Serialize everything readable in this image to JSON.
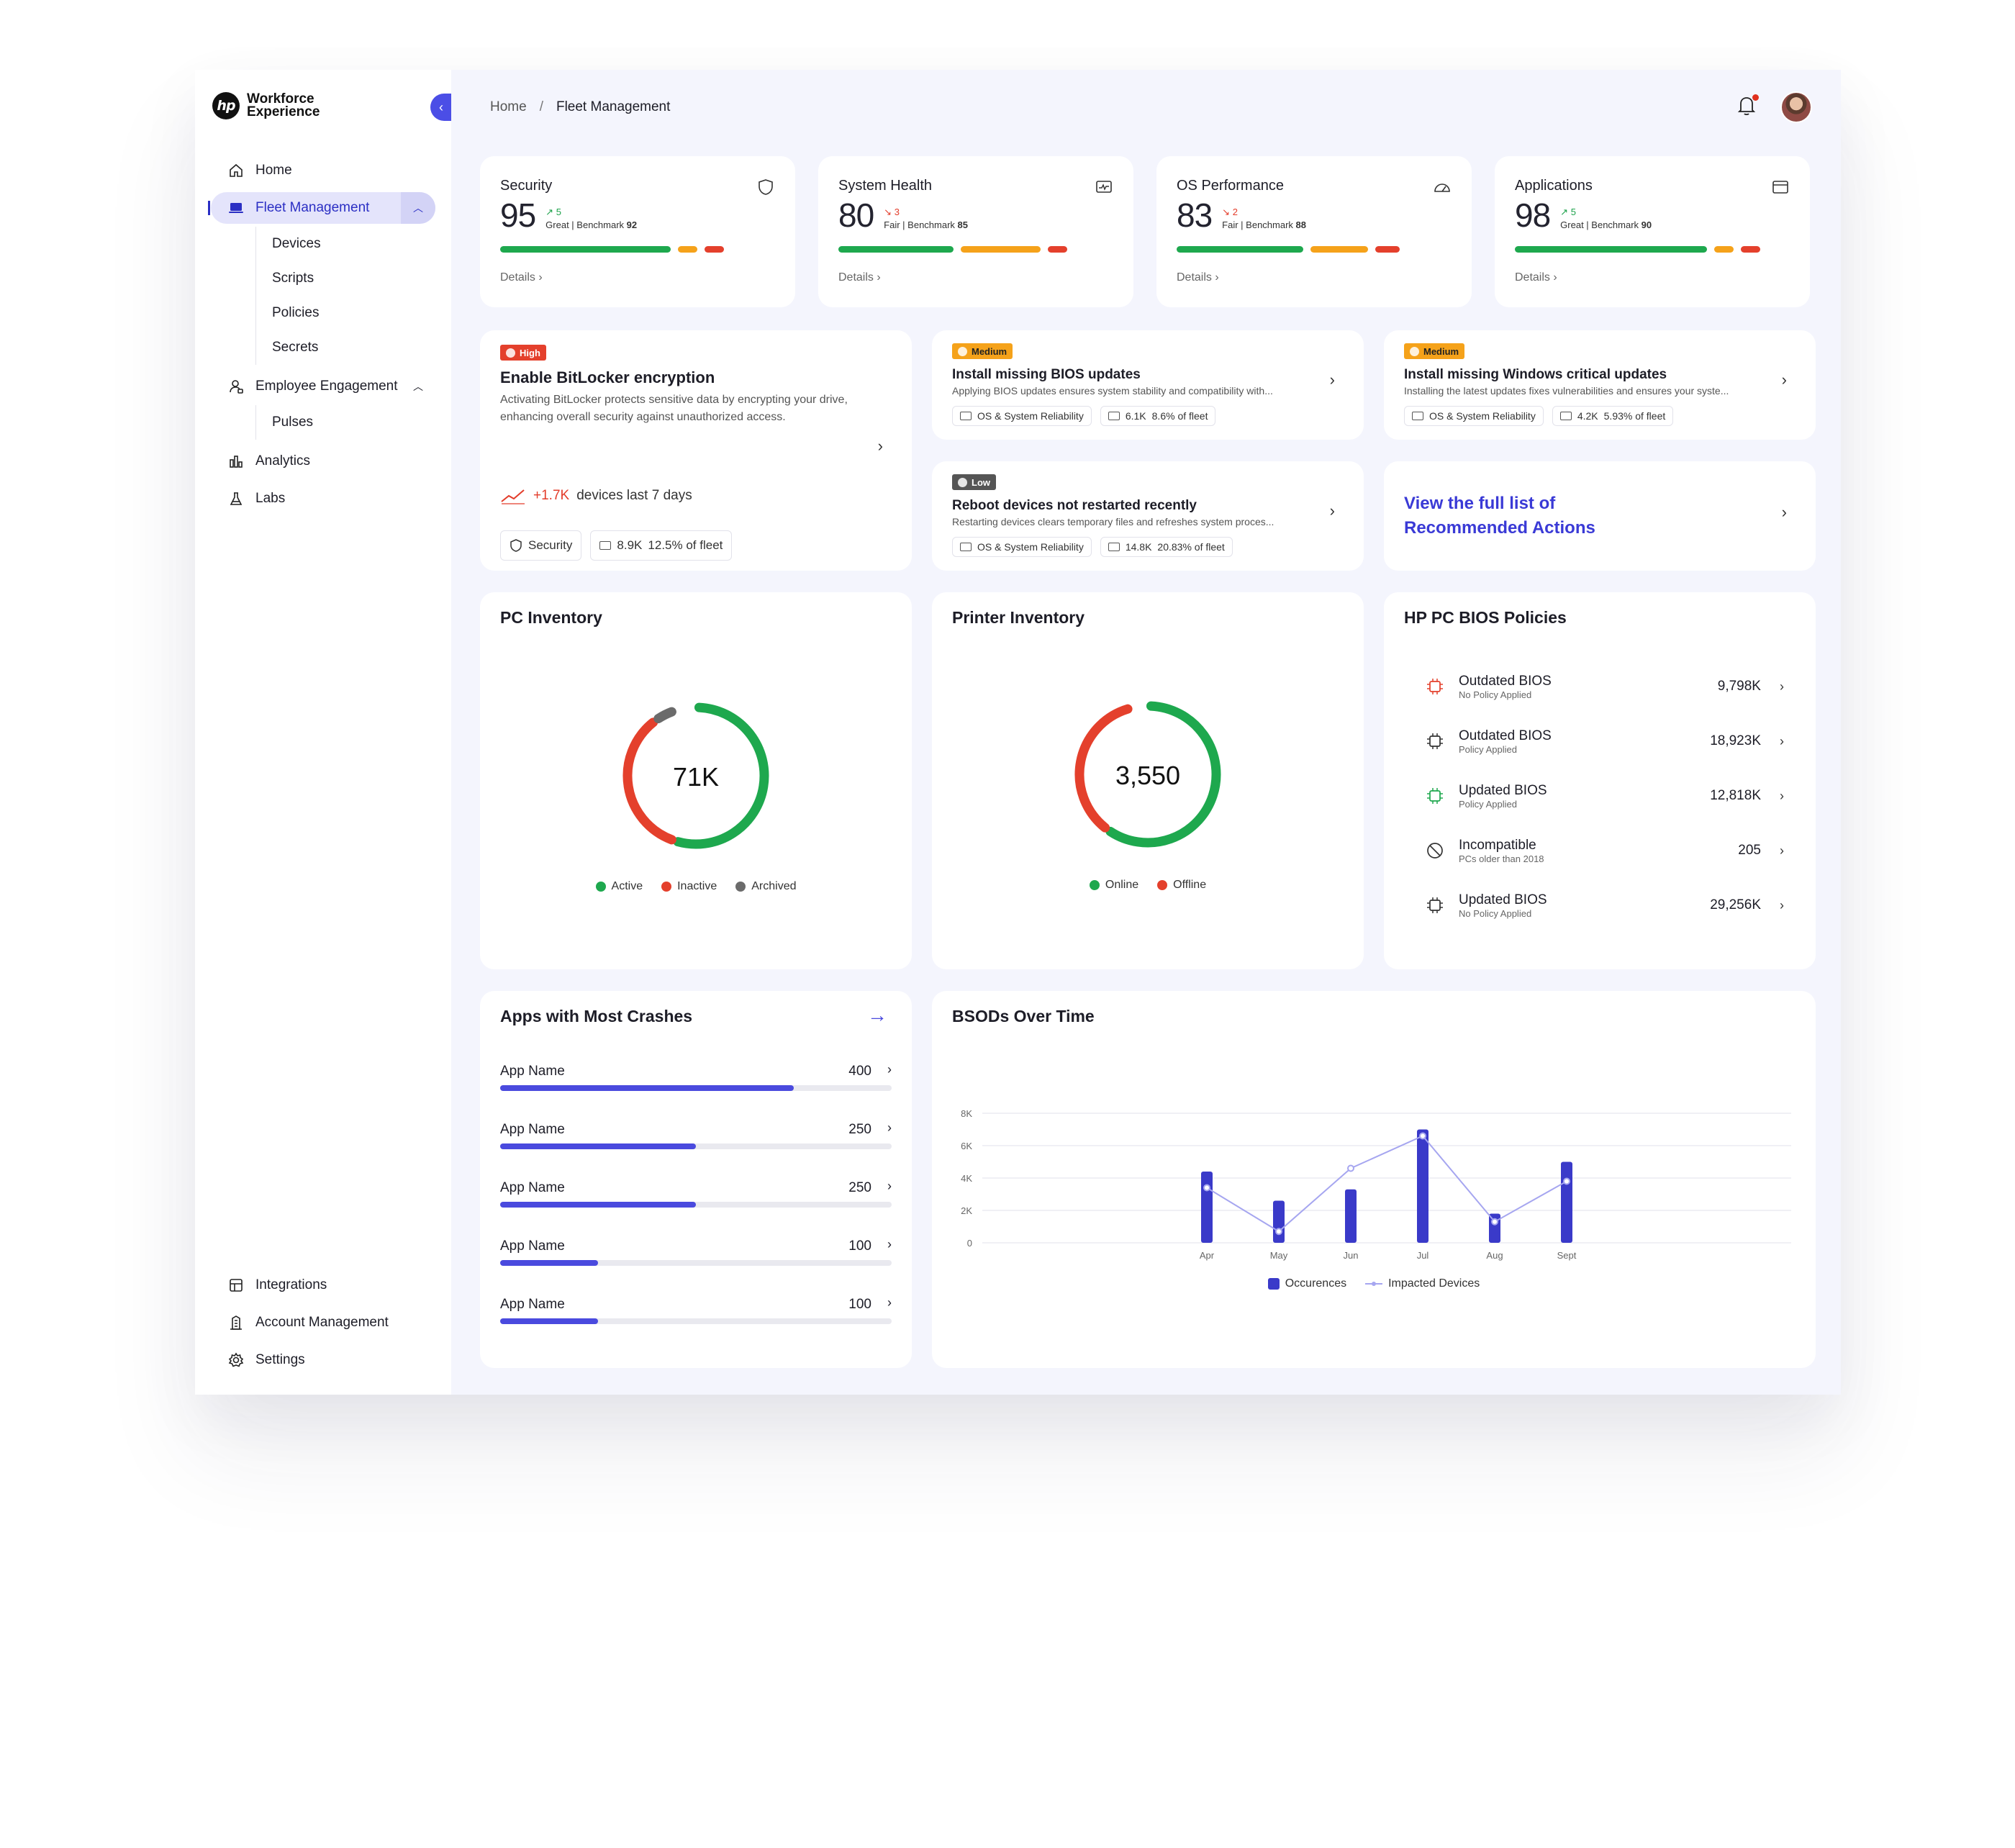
{
  "brand": {
    "name": "Workforce Experience",
    "logo_text": "hp"
  },
  "sidebar": {
    "items": [
      {
        "label": "Home",
        "icon": "home-icon"
      },
      {
        "label": "Fleet Management",
        "icon": "laptop-icon",
        "active": true
      },
      {
        "label": "Employee Engagement",
        "icon": "user-icon"
      },
      {
        "label": "Analytics",
        "icon": "bar-chart-icon"
      },
      {
        "label": "Labs",
        "icon": "flask-icon"
      }
    ],
    "fleet_sub": [
      "Devices",
      "Scripts",
      "Policies",
      "Secrets"
    ],
    "engagement_sub": [
      "Pulses"
    ],
    "bottom": [
      {
        "label": "Integrations",
        "icon": "integrations-icon"
      },
      {
        "label": "Account Management",
        "icon": "building-icon"
      },
      {
        "label": "Settings",
        "icon": "gear-icon"
      }
    ]
  },
  "breadcrumb": {
    "home": "Home",
    "sep": "/",
    "current": "Fleet Management"
  },
  "scores": [
    {
      "title": "Security",
      "value": "95",
      "delta": "5",
      "dir": "up",
      "rating": "Great",
      "benchmark_label": "Benchmark",
      "benchmark": "92",
      "icon": "shield-icon",
      "bars": [
        0.62,
        0.07,
        0.07
      ],
      "details": "Details"
    },
    {
      "title": "System Health",
      "value": "80",
      "delta": "3",
      "dir": "down",
      "rating": "Fair",
      "benchmark_label": "Benchmark",
      "benchmark": "85",
      "icon": "monitor-pulse-icon",
      "bars": [
        0.42,
        0.29,
        0.07
      ],
      "details": "Details"
    },
    {
      "title": "OS Performance",
      "value": "83",
      "delta": "2",
      "dir": "down",
      "rating": "Fair",
      "benchmark_label": "Benchmark",
      "benchmark": "88",
      "icon": "speedometer-icon",
      "bars": [
        0.46,
        0.21,
        0.09
      ],
      "details": "Details"
    },
    {
      "title": "Applications",
      "value": "98",
      "delta": "5",
      "dir": "up",
      "rating": "Great",
      "benchmark_label": "Benchmark",
      "benchmark": "90",
      "icon": "window-icon",
      "bars": [
        0.7,
        0.07,
        0.07
      ],
      "details": "Details"
    }
  ],
  "actions": {
    "main": {
      "severity": "High",
      "title": "Enable BitLocker encryption",
      "desc": "Activating BitLocker protects sensitive data by encrypting your drive, enhancing overall security against unauthorized access.",
      "trend_value": "+1.7K",
      "trend_text": "devices last 7 days",
      "chip1": "Security",
      "chip2_count": "8.9K",
      "chip2_pct": "12.5% of fleet"
    },
    "bios": {
      "severity": "Medium",
      "title": "Install missing BIOS updates",
      "desc": "Applying BIOS updates ensures system stability and compatibility with...",
      "chip1": "OS & System Reliability",
      "chip2_count": "6.1K",
      "chip2_pct": "8.6% of fleet"
    },
    "windows": {
      "severity": "Medium",
      "title": "Install missing Windows critical updates",
      "desc": "Installing the latest updates fixes vulnerabilities and ensures your syste...",
      "chip1": "OS & System Reliability",
      "chip2_count": "4.2K",
      "chip2_pct": "5.93% of fleet"
    },
    "reboot": {
      "severity": "Low",
      "title": "Reboot devices not restarted recently",
      "desc": "Restarting devices clears temporary files and refreshes system proces...",
      "chip1": "OS & System Reliability",
      "chip2_count": "14.8K",
      "chip2_pct": "20.83% of fleet"
    },
    "view_all": "View the full list of Recommended Actions"
  },
  "pc_inventory": {
    "title": "PC Inventory",
    "center": "71K",
    "segments": [
      {
        "label": "Active",
        "value": 0.55,
        "color": "#1ea84e"
      },
      {
        "label": "Inactive",
        "value": 0.35,
        "color": "#e4402c"
      },
      {
        "label": "Archived",
        "value": 0.05,
        "color": "#6b6b6b"
      }
    ]
  },
  "printer_inventory": {
    "title": "Printer Inventory",
    "center": "3,550",
    "segments": [
      {
        "label": "Online",
        "value": 0.6,
        "color": "#1ea84e"
      },
      {
        "label": "Offline",
        "value": 0.36,
        "color": "#e4402c"
      }
    ]
  },
  "bios_policies": {
    "title": "HP PC BIOS Policies",
    "rows": [
      {
        "name": "Outdated BIOS",
        "sub": "No Policy Applied",
        "value": "9,798K",
        "icon": "chip-alert-icon",
        "color": "#e4402c"
      },
      {
        "name": "Outdated BIOS",
        "sub": "Policy Applied",
        "value": "18,923K",
        "icon": "chip-policy-icon",
        "color": "#333"
      },
      {
        "name": "Updated BIOS",
        "sub": "Policy Applied",
        "value": "12,818K",
        "icon": "chip-check-icon",
        "color": "#1ea84e"
      },
      {
        "name": "Incompatible",
        "sub": "PCs older than 2018",
        "value": "205",
        "icon": "block-icon",
        "color": "#333"
      },
      {
        "name": "Updated BIOS",
        "sub": "No Policy Applied",
        "value": "29,256K",
        "icon": "chip-icon",
        "color": "#333"
      }
    ]
  },
  "crashes": {
    "title": "Apps with Most Crashes",
    "rows": [
      {
        "name": "App Name",
        "value": "400",
        "pct": 0.75
      },
      {
        "name": "App Name",
        "value": "250",
        "pct": 0.5
      },
      {
        "name": "App Name",
        "value": "250",
        "pct": 0.5
      },
      {
        "name": "App Name",
        "value": "100",
        "pct": 0.25
      },
      {
        "name": "App Name",
        "value": "100",
        "pct": 0.25
      }
    ]
  },
  "chart_data": {
    "type": "bar",
    "title": "BSODs Over Time",
    "categories": [
      "Apr",
      "May",
      "Jun",
      "Jul",
      "Aug",
      "Sept"
    ],
    "series": [
      {
        "name": "Occurences",
        "type": "bar",
        "values": [
          4400,
          2600,
          3300,
          7000,
          1800,
          5000
        ],
        "color": "#3a3ac9"
      },
      {
        "name": "Impacted Devices",
        "type": "line",
        "values": [
          3400,
          700,
          4600,
          6600,
          1300,
          3800
        ],
        "color": "#a6a6f0"
      }
    ],
    "ylim": [
      0,
      8000
    ],
    "yticks": [
      "0",
      "2K",
      "4K",
      "6K",
      "8K"
    ],
    "grid": true,
    "legend": "bottom"
  }
}
